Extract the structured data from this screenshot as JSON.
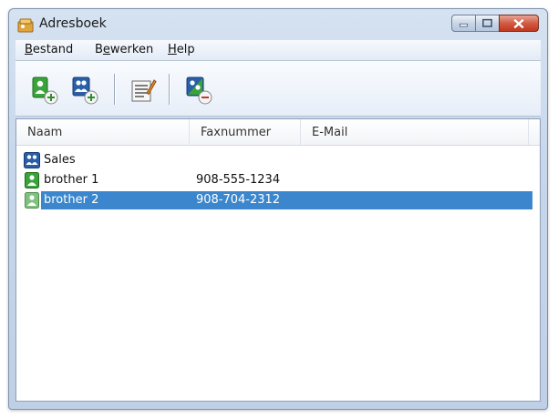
{
  "window": {
    "title": "Adresboek"
  },
  "menu": [
    {
      "label": "Bestand",
      "mnemonic": "B",
      "rest": "estand"
    },
    {
      "label": "Bewerken",
      "mnemonic": "e",
      "rest": "werken",
      "prefix": "B"
    },
    {
      "label": "Help",
      "mnemonic": "H",
      "rest": "elp"
    }
  ],
  "toolbar": {
    "buttons": [
      {
        "name": "add-contact-button",
        "icon": "person-add-icon"
      },
      {
        "name": "add-group-button",
        "icon": "group-add-icon"
      },
      {
        "name": "edit-button",
        "icon": "edit-list-icon"
      },
      {
        "name": "delete-button",
        "icon": "delete-contact-icon"
      }
    ]
  },
  "list": {
    "columns": [
      "Naam",
      "Faxnummer",
      "E-Mail"
    ],
    "rows": [
      {
        "name": "Sales",
        "fax": "",
        "email": "",
        "type": "group",
        "icon": "group-icon"
      },
      {
        "name": "brother 1",
        "fax": "908-555-1234",
        "email": "",
        "type": "contact",
        "icon": "contact-icon"
      },
      {
        "name": "brother 2",
        "fax": "908-704-2312",
        "email": "",
        "type": "contact",
        "icon": "contact-icon",
        "selected": true
      }
    ]
  },
  "colors": {
    "selection": "#3b86cc",
    "close_button": "#c1381f",
    "contact_green": "#3aa33a",
    "group_blue": "#2a5fa8"
  }
}
